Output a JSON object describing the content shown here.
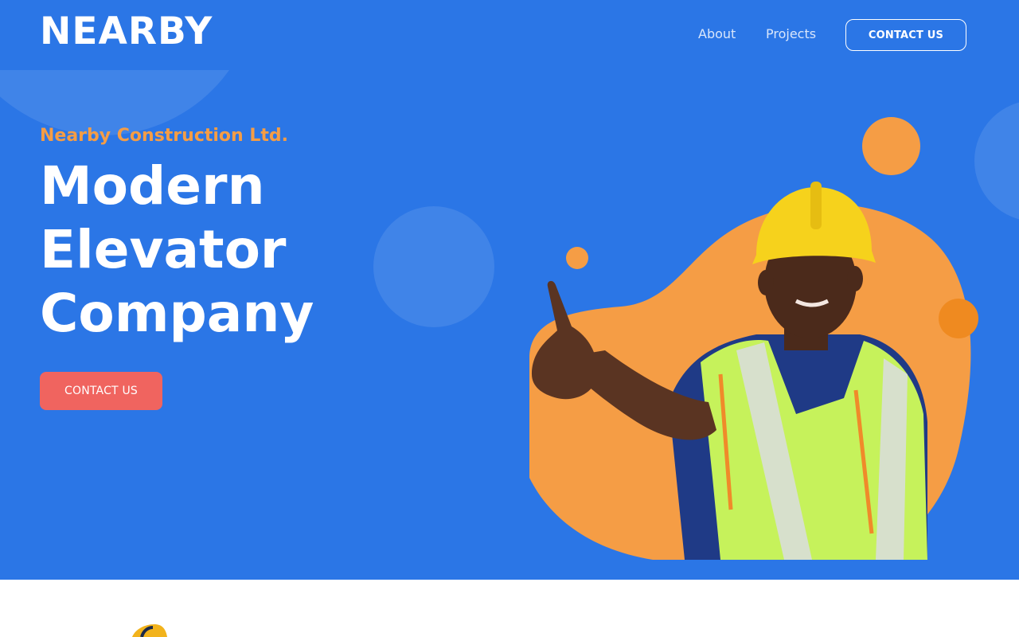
{
  "brand": {
    "logo": "NEARBY"
  },
  "nav": {
    "about": "About",
    "projects": "Projects",
    "contact": "CONTACT US"
  },
  "hero": {
    "tagline": "Nearby Construction Ltd.",
    "headline_lines": [
      "Modern",
      "Elevator",
      "Company"
    ],
    "cta": "CONTACT US",
    "image": "construction-worker-pointing-photo"
  },
  "colors": {
    "hero_bg": "#2b76e6",
    "accent_orange": "#f59d45",
    "cta_red": "#f0645f",
    "white": "#ffffff"
  }
}
